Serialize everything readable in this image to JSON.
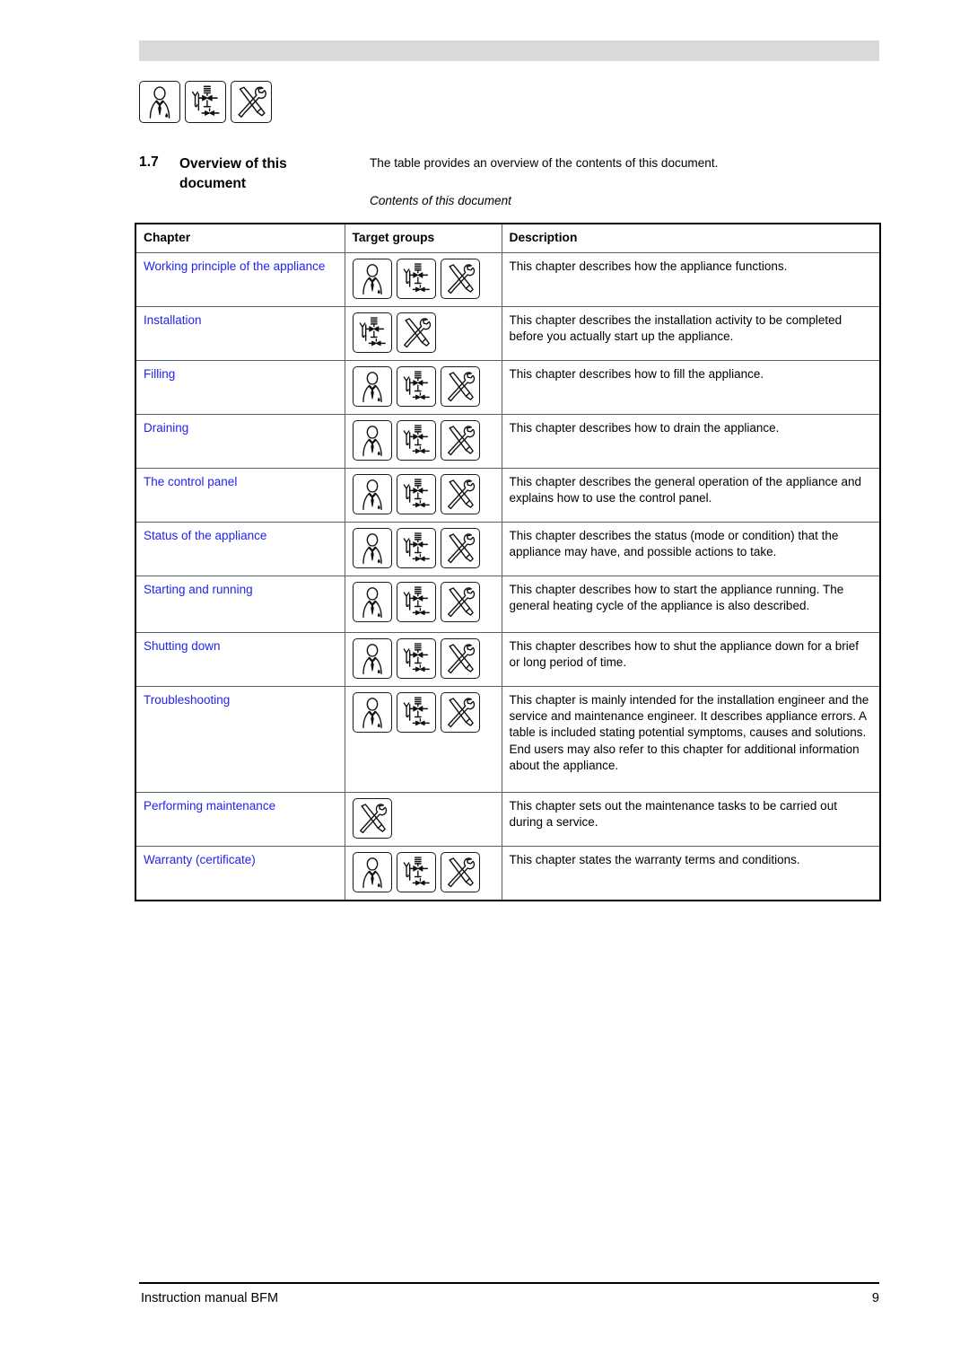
{
  "document": {
    "section_number": "1.7",
    "section_title": "Overview of this document",
    "intro_text": "The table provides an overview of the contents of this document.",
    "table_caption": "Contents of this document"
  },
  "header_icons": [
    "end-user-icon",
    "installation-engineer-icon",
    "service-engineer-icon"
  ],
  "table": {
    "headers": {
      "chapter": "Chapter",
      "target_groups": "Target groups",
      "description": "Description"
    },
    "rows": [
      {
        "chapter": "Working principle of the appliance",
        "icons": [
          "end-user-icon",
          "installation-engineer-icon",
          "service-engineer-icon"
        ],
        "description": "This chapter describes how the appliance functions."
      },
      {
        "chapter": "Installation",
        "icons": [
          "installation-engineer-icon",
          "service-engineer-icon"
        ],
        "description": "This chapter describes the installation activity to be completed before you actually start up the appliance."
      },
      {
        "chapter": "Filling",
        "icons": [
          "end-user-icon",
          "installation-engineer-icon",
          "service-engineer-icon"
        ],
        "description": "This chapter describes how to fill the appliance."
      },
      {
        "chapter": "Draining",
        "icons": [
          "end-user-icon",
          "installation-engineer-icon",
          "service-engineer-icon"
        ],
        "description": "This chapter describes how to drain the appliance."
      },
      {
        "chapter": "The control panel",
        "icons": [
          "end-user-icon",
          "installation-engineer-icon",
          "service-engineer-icon"
        ],
        "description": "This chapter describes the general operation of the appliance and explains how to use the control panel."
      },
      {
        "chapter": "Status of the appliance",
        "icons": [
          "end-user-icon",
          "installation-engineer-icon",
          "service-engineer-icon"
        ],
        "description": "This chapter describes the status (mode or condition) that the appliance may have, and possible actions to take."
      },
      {
        "chapter": "Starting and running",
        "icons": [
          "end-user-icon",
          "installation-engineer-icon",
          "service-engineer-icon"
        ],
        "description": "This chapter describes how to start the appliance running. The general heating cycle of the appliance is also described."
      },
      {
        "chapter": "Shutting down",
        "icons": [
          "end-user-icon",
          "installation-engineer-icon",
          "service-engineer-icon"
        ],
        "description": "This chapter describes how to shut the appliance down for a brief or long period of time."
      },
      {
        "chapter": "Troubleshooting",
        "icons": [
          "end-user-icon",
          "installation-engineer-icon",
          "service-engineer-icon"
        ],
        "description": "This chapter is mainly intended for the installation engineer and the service and maintenance engineer. It describes appliance errors. A table is included stating potential symptoms, causes and solutions. End users may also refer to this chapter for additional information about the appliance."
      },
      {
        "chapter": "Performing maintenance",
        "icons": [
          "service-engineer-icon"
        ],
        "description": "This chapter sets out the maintenance tasks to be carried out during a service."
      },
      {
        "chapter": "Warranty (certificate)",
        "icons": [
          "end-user-icon",
          "installation-engineer-icon",
          "service-engineer-icon"
        ],
        "description": "This chapter states the warranty terms and conditions."
      }
    ]
  },
  "footer": {
    "manual_name": "Instruction manual BFM",
    "page_number": "9"
  },
  "colors": {
    "link": "#2222ee",
    "banner": "#d9d9d9",
    "text": "#000000"
  }
}
